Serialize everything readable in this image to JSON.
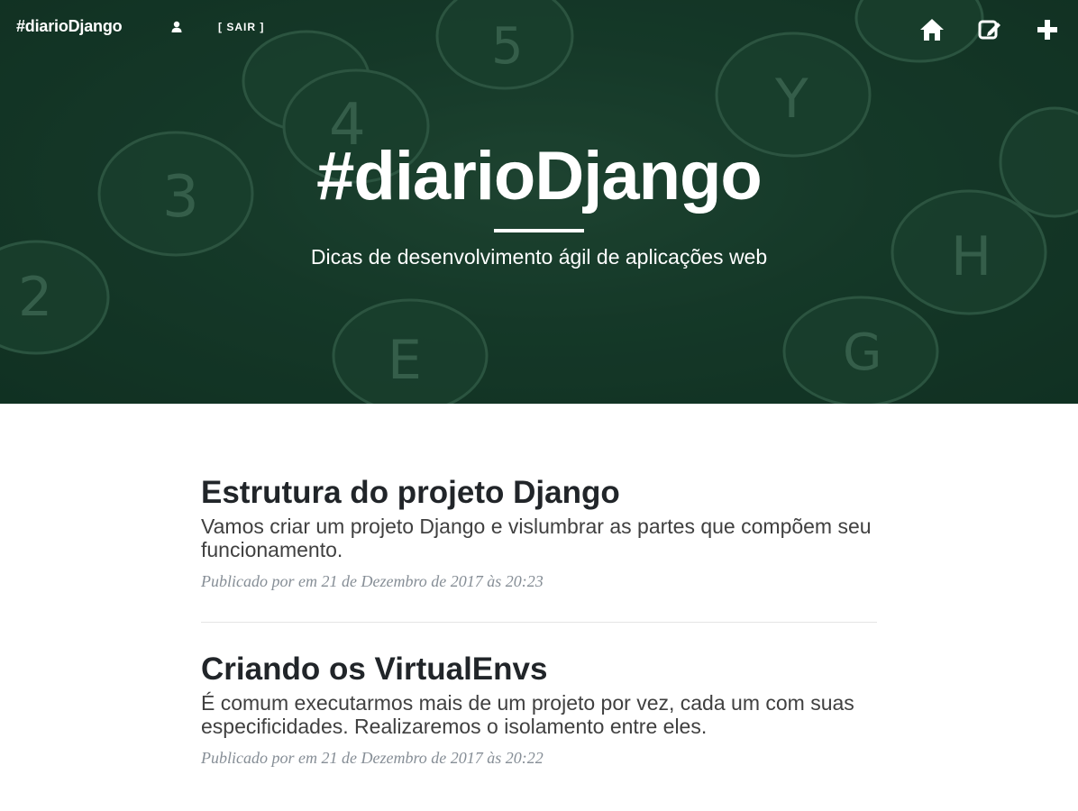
{
  "nav": {
    "brand": "#diarioDjango",
    "logout_label": "[ SAIR ]",
    "icons": [
      "user-icon",
      "home-icon",
      "edit-icon",
      "plus-icon"
    ]
  },
  "hero": {
    "title": "#diarioDjango",
    "subtitle": "Dicas de desenvolvimento ágil de aplicações web"
  },
  "posts": [
    {
      "title": "Estrutura do projeto Django",
      "subtitle": "Vamos criar um projeto Django e vislumbrar as partes que compõem seu funcionamento.",
      "meta": "Publicado por em 21 de Dezembro de 2017 às 20:23"
    },
    {
      "title": "Criando os VirtualEnvs",
      "subtitle": "É comum executarmos mais de um projeto por vez, cada um com suas especificidades. Realizaremos o isolamento entre eles.",
      "meta": "Publicado por em 21 de Dezembro de 2017 às 20:22"
    }
  ],
  "colors": {
    "hero_bg": "#163a2a",
    "text_dark": "#212529",
    "meta_gray": "#868e96"
  }
}
